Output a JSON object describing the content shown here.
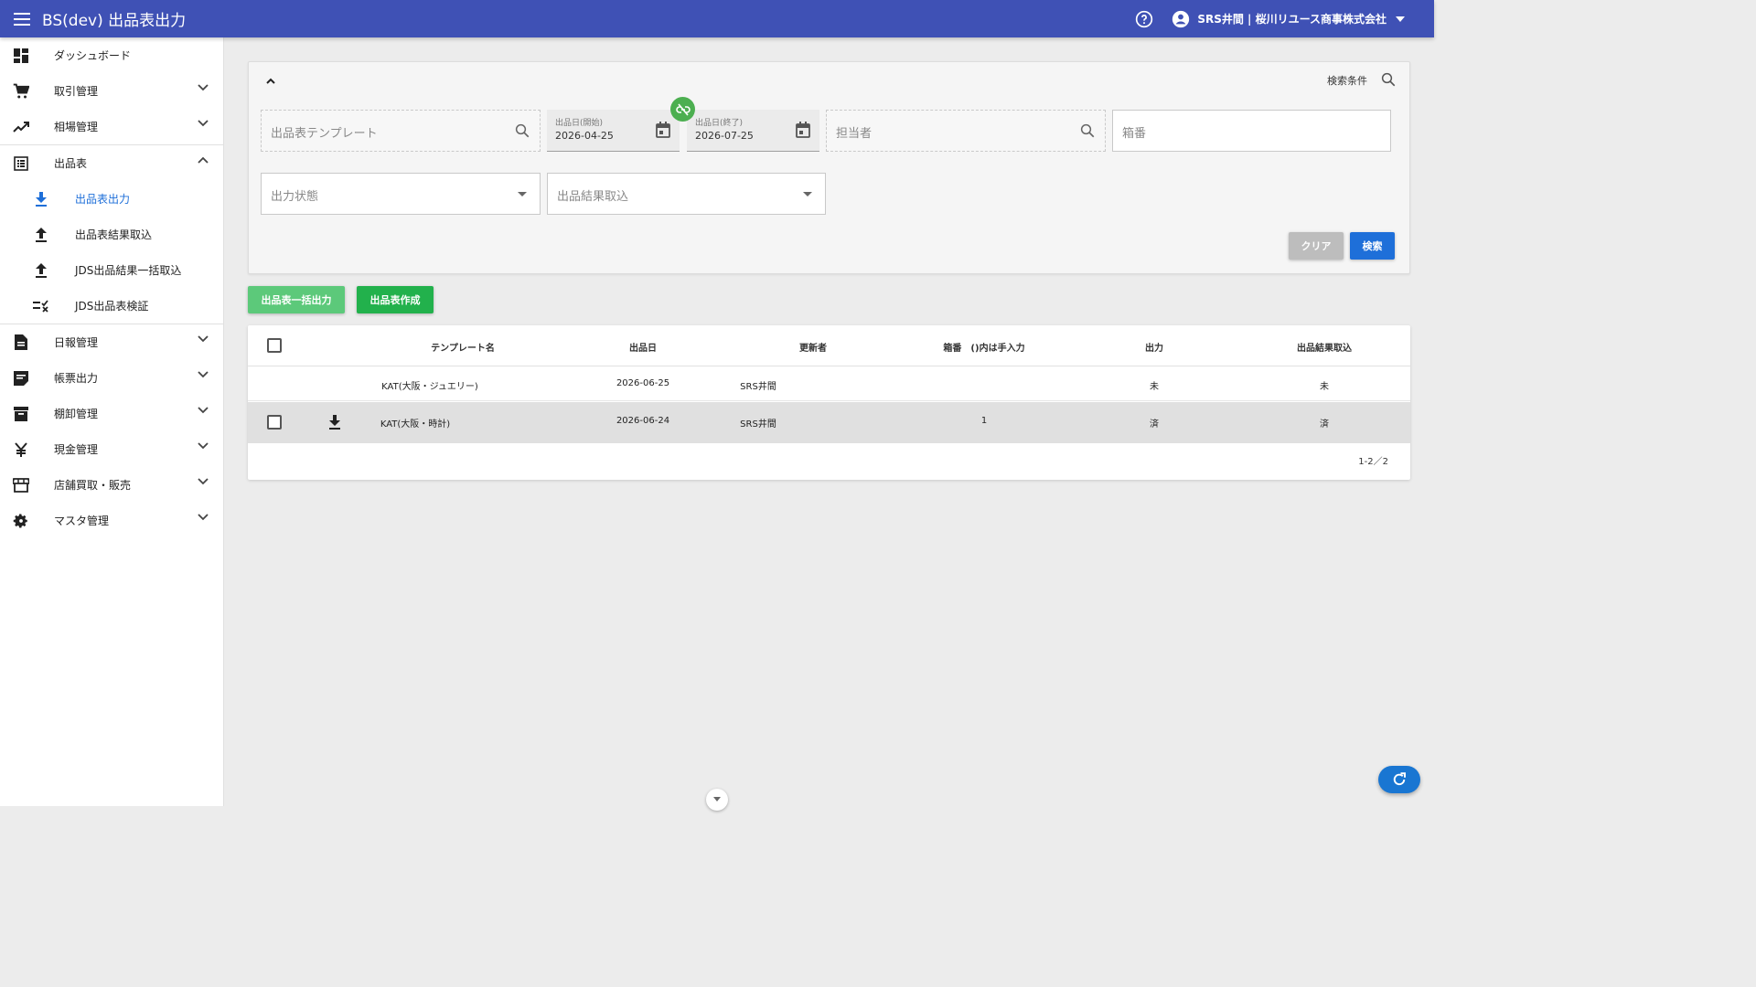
{
  "appbar": {
    "title": "BS(dev) 出品表出力",
    "user": "SRS井間 | 桜川リユース商事株式会社"
  },
  "sidebar": {
    "items": [
      {
        "label": "ダッシュボード",
        "icon": "dashboard-icon"
      },
      {
        "label": "取引管理",
        "icon": "cart-icon"
      },
      {
        "label": "相場管理",
        "icon": "trending-up-icon"
      },
      {
        "label": "出品表",
        "icon": "list-alt-icon"
      },
      {
        "label": "日報管理",
        "icon": "description-icon"
      },
      {
        "label": "帳票出力",
        "icon": "note-icon"
      },
      {
        "label": "棚卸管理",
        "icon": "archive-icon"
      },
      {
        "label": "現金管理",
        "icon": "yen-icon"
      },
      {
        "label": "店舗買取・販売",
        "icon": "store-icon"
      },
      {
        "label": "マスタ管理",
        "icon": "gear-icon"
      }
    ],
    "subitems": [
      {
        "label": "出品表出力",
        "icon": "download-icon"
      },
      {
        "label": "出品表結果取込",
        "icon": "upload-icon"
      },
      {
        "label": "JDS出品結果一括取込",
        "icon": "upload-icon"
      },
      {
        "label": "JDS出品表検証",
        "icon": "checklist-icon"
      }
    ]
  },
  "search": {
    "condition_label": "検索条件",
    "template_placeholder": "出品表テンプレート",
    "date_start_label": "出品日(開始)",
    "date_start_value": "2026-04-25",
    "date_end_label": "出品日(終了)",
    "date_end_value": "2026-07-25",
    "person_placeholder": "担当者",
    "box_placeholder": "箱番",
    "output_status_placeholder": "出力状態",
    "result_import_placeholder": "出品結果取込",
    "clear_label": "クリア",
    "search_label": "検索"
  },
  "actions": {
    "bulk_output_label": "出品表一括出力",
    "create_label": "出品表作成"
  },
  "table": {
    "headers": [
      "テンプレート名",
      "出品日",
      "更新者",
      "箱番　()内は手入力",
      "出力",
      "出品結果取込"
    ],
    "rows": [
      {
        "template": "KAT(大阪・ジュエリー)",
        "date": "2026-06-25",
        "updater": "SRS井間",
        "box": "",
        "output": "未",
        "result": "未"
      },
      {
        "template": "KAT(大阪・時計)",
        "date": "2026-06-24",
        "updater": "SRS井間",
        "box": "1",
        "output": "済",
        "result": "済"
      }
    ],
    "pagination": "1-2／2"
  },
  "colors": {
    "appbar": "#3f51b5",
    "primary": "#1e6fd9",
    "green": "#22b14c",
    "green_light": "#5cc97a",
    "clear_gray": "#bdbdbd"
  }
}
